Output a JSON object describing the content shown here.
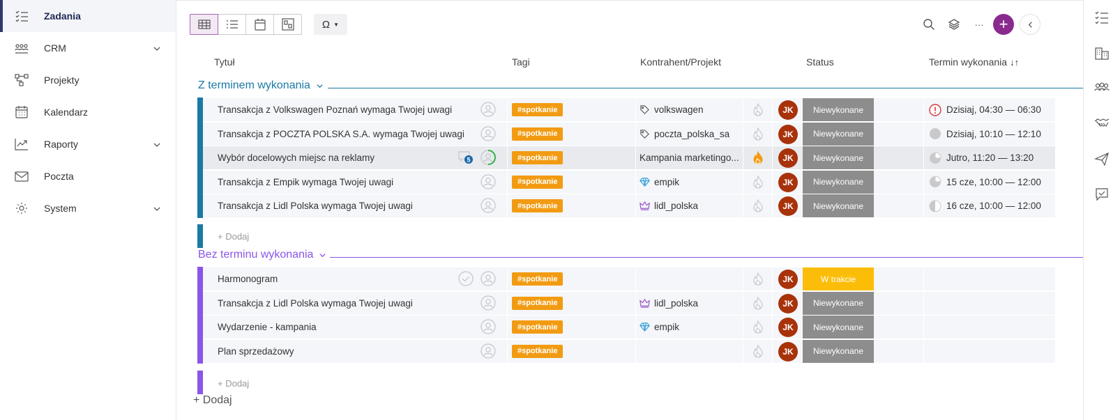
{
  "colors": {
    "accent": "#8b2a8e",
    "group1": "#1a7aa4",
    "group2": "#8b55e8",
    "tag": "#f29b12",
    "status_todo": "#8d8d8d",
    "status_progress": "#fbbd08",
    "avatar": "#a8320a"
  },
  "sidebar": {
    "items": [
      {
        "label": "Zadania",
        "icon": "tasks-icon",
        "active": true
      },
      {
        "label": "CRM",
        "icon": "crm-icon",
        "expandable": true
      },
      {
        "label": "Projekty",
        "icon": "projects-icon"
      },
      {
        "label": "Kalendarz",
        "icon": "calendar-icon"
      },
      {
        "label": "Raporty",
        "icon": "reports-icon",
        "expandable": true
      },
      {
        "label": "Poczta",
        "icon": "mail-icon"
      },
      {
        "label": "System",
        "icon": "gear-icon",
        "expandable": true
      }
    ]
  },
  "toolbar": {
    "views": [
      "table-view-icon",
      "list-view-icon",
      "calendar-view-icon",
      "board-view-icon"
    ],
    "omega": "Ω",
    "more": "···",
    "add": "+"
  },
  "columns": {
    "title": "Tytuł",
    "tags": "Tagi",
    "contractor": "Kontrahent/Projekt",
    "status": "Status",
    "due": "Termin wykonania"
  },
  "groups": [
    {
      "label": "Z terminem wykonania",
      "add_label": "+ Dodaj",
      "rows": [
        {
          "title": "Transakcja z Volkswagen Poznań wymaga Twojej uwagi",
          "tag": "#spotkanie",
          "contractor": "volkswagen",
          "contractor_icon": "tag-icon",
          "avatar": "JK",
          "status": "Niewykonane",
          "due": "Dzisiaj, 04:30 — 06:30",
          "due_icon": "alert-icon"
        },
        {
          "title": "Transakcja z POCZTA POLSKA S.A. wymaga Twojej uwagi",
          "tag": "#spotkanie",
          "contractor": "poczta_polska_sa",
          "contractor_icon": "tag-icon",
          "avatar": "JK",
          "status": "Niewykonane",
          "due": "Dzisiaj, 10:10 — 12:10",
          "due_icon": "full-circle-icon"
        },
        {
          "title": "Wybór docelowych miejsc na reklamy",
          "tag": "#spotkanie",
          "contractor": "Kampania marketingo...",
          "contractor_icon": "",
          "comments": "5",
          "avatar": "JK",
          "status": "Niewykonane",
          "due": "Jutro, 11:20 — 13:20",
          "due_icon": "three-quarter-circle-icon"
        },
        {
          "title": "Transakcja z Empik wymaga Twojej uwagi",
          "tag": "#spotkanie",
          "contractor": "empik",
          "contractor_icon": "diamond-icon",
          "avatar": "JK",
          "status": "Niewykonane",
          "due": "15 cze, 10:00 — 12:00",
          "due_icon": "three-quarter-circle-icon"
        },
        {
          "title": "Transakcja z Lidl Polska wymaga Twojej uwagi",
          "tag": "#spotkanie",
          "contractor": "lidl_polska",
          "contractor_icon": "crown-icon",
          "avatar": "JK",
          "status": "Niewykonane",
          "due": "16 cze, 10:00 — 12:00",
          "due_icon": "half-circle-icon"
        }
      ]
    },
    {
      "label": "Bez terminu wykonania",
      "add_label": "+ Dodaj",
      "rows": [
        {
          "title": "Harmonogram",
          "tag": "#spotkanie",
          "contractor": "",
          "avatar": "JK",
          "status": "W trakcie"
        },
        {
          "title": "Transakcja z Lidl Polska wymaga Twojej uwagi",
          "tag": "#spotkanie",
          "contractor": "lidl_polska",
          "contractor_icon": "crown-icon",
          "avatar": "JK",
          "status": "Niewykonane"
        },
        {
          "title": "Wydarzenie - kampania",
          "tag": "#spotkanie",
          "contractor": "empik",
          "contractor_icon": "diamond-icon",
          "avatar": "JK",
          "status": "Niewykonane"
        },
        {
          "title": "Plan sprzedażowy",
          "tag": "#spotkanie",
          "contractor": "",
          "avatar": "JK",
          "status": "Niewykonane"
        }
      ]
    }
  ],
  "add_main": "+ Dodaj"
}
